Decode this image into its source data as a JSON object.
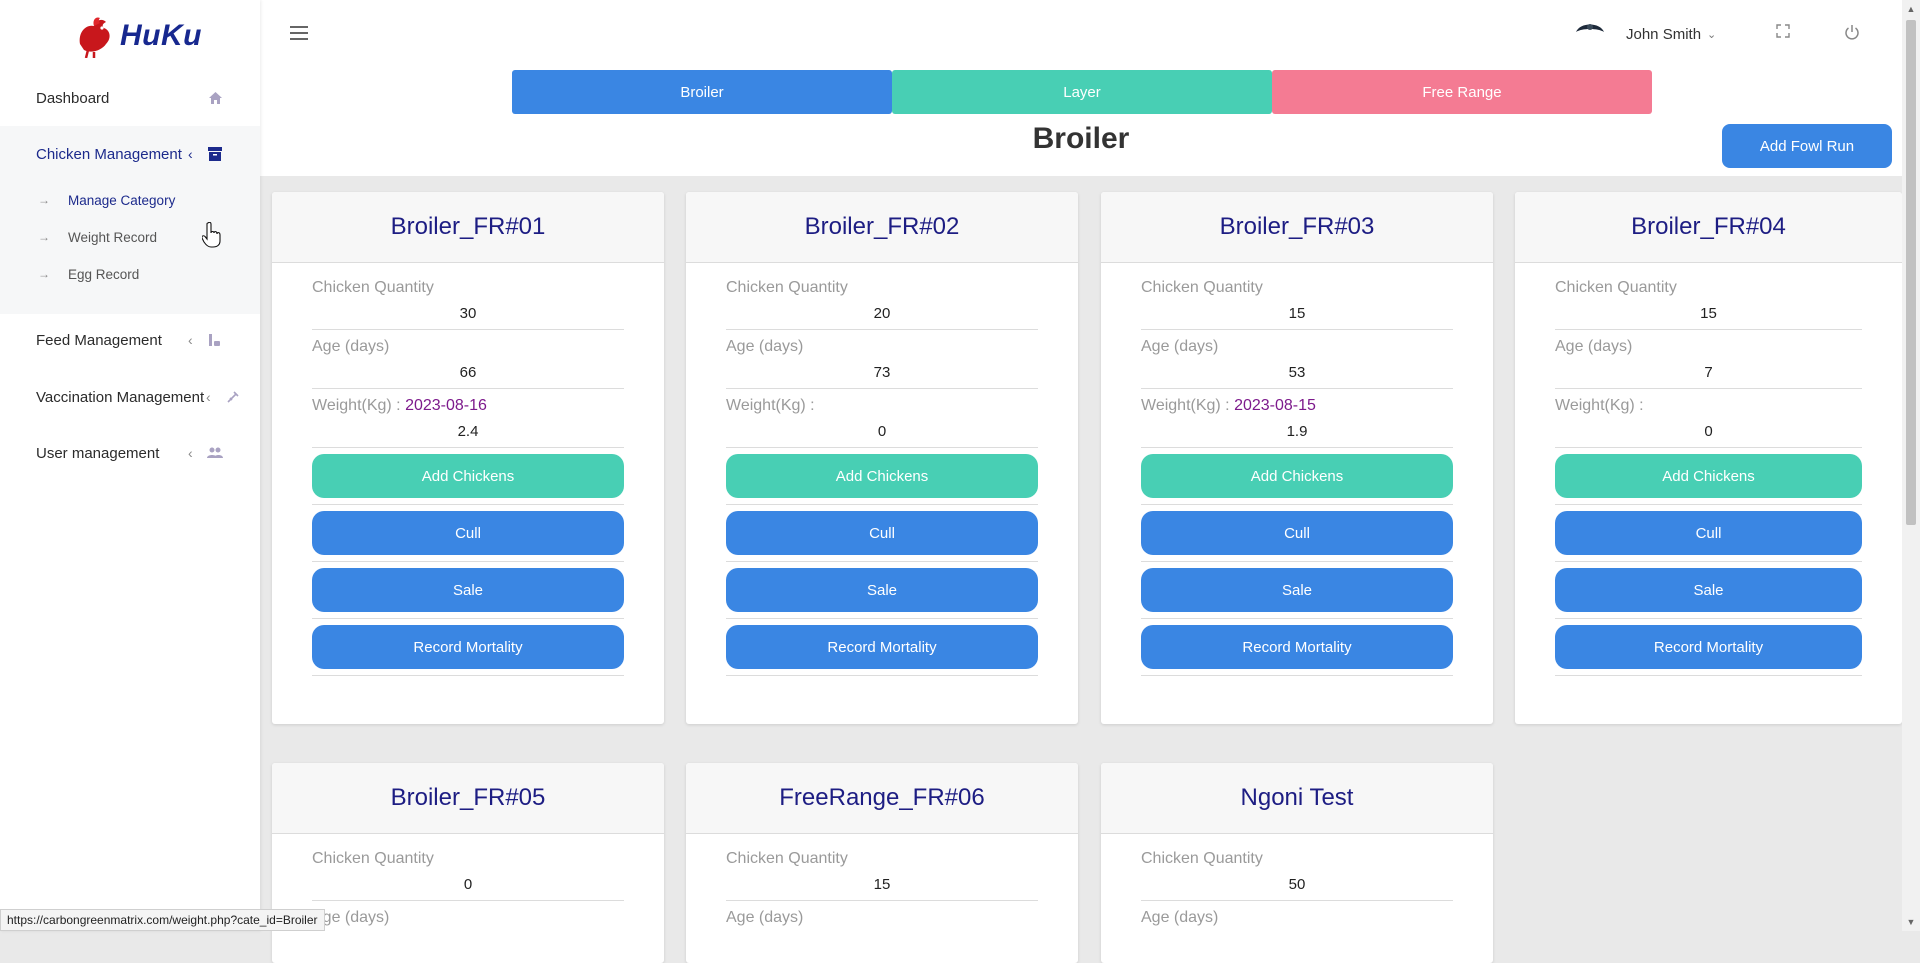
{
  "app": {
    "name": "HuKu"
  },
  "sidebar": {
    "items": [
      {
        "label": "Dashboard"
      },
      {
        "label": "Chicken Management",
        "sub": [
          {
            "label": "Manage Category"
          },
          {
            "label": "Weight Record"
          },
          {
            "label": "Egg Record"
          }
        ]
      },
      {
        "label": "Feed Management"
      },
      {
        "label": "Vaccination Management"
      },
      {
        "label": "User management"
      }
    ]
  },
  "header": {
    "user_name": "John Smith"
  },
  "category_tabs": [
    {
      "label": "Broiler",
      "color": "#3a86e3"
    },
    {
      "label": "Layer",
      "color": "#48cfb4"
    },
    {
      "label": "Free Range",
      "color": "#f47b93"
    }
  ],
  "page": {
    "title": "Broiler",
    "add_button": "Add Fowl Run"
  },
  "field_labels": {
    "quantity": "Chicken Quantity",
    "age": "Age (days)",
    "weight": "Weight(Kg) :"
  },
  "button_labels": {
    "add": "Add Chickens",
    "cull": "Cull",
    "sale": "Sale",
    "mortality": "Record Mortality"
  },
  "cards": [
    {
      "title": "Broiler_FR#01",
      "quantity": "30",
      "age": "66",
      "weight_date": "2023-08-16",
      "weight": "2.4"
    },
    {
      "title": "Broiler_FR#02",
      "quantity": "20",
      "age": "73",
      "weight_date": "",
      "weight": "0"
    },
    {
      "title": "Broiler_FR#03",
      "quantity": "15",
      "age": "53",
      "weight_date": "2023-08-15",
      "weight": "1.9"
    },
    {
      "title": "Broiler_FR#04",
      "quantity": "15",
      "age": "7",
      "weight_date": "",
      "weight": "0"
    },
    {
      "title": "Broiler_FR#05",
      "quantity": "0"
    },
    {
      "title": "FreeRange_FR#06",
      "quantity": "15"
    },
    {
      "title": "Ngoni Test",
      "quantity": "50"
    }
  ],
  "status_bar": {
    "url": "https://carbongreenmatrix.com/weight.php?cate_id=Broiler"
  }
}
